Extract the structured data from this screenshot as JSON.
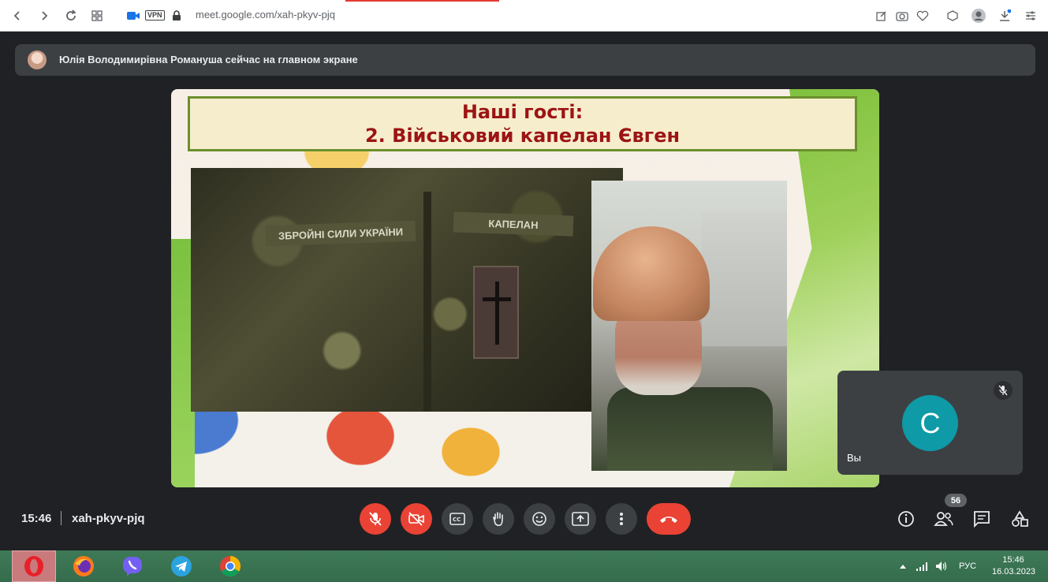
{
  "browser": {
    "url": "meet.google.com/xah-pkyv-pjq",
    "vpn_label": "VPN"
  },
  "meet": {
    "presenter_notice": "Юлія Володимирівна Романуша сейчас на главном экране",
    "time": "15:46",
    "meeting_code": "xah-pkyv-pjq",
    "self_label": "Вы",
    "self_initial": "С",
    "participants_count": "56",
    "colors": {
      "end_call": "#ea4335",
      "avatar": "#0f9aa7",
      "background": "#202124"
    }
  },
  "slide": {
    "title_line1": "Наші гості:",
    "title_line2": "2. Військовий капелан Євген",
    "patch_left": "ЗБРОЙНІ СИЛИ УКРАЇНИ",
    "patch_right": "КАПЕЛАН"
  },
  "taskbar": {
    "apps": [
      "opera-icon",
      "firefox-icon",
      "viber-icon",
      "telegram-icon",
      "chrome-icon"
    ],
    "language": "РУС",
    "time": "15:46",
    "date": "16.03.2023"
  }
}
